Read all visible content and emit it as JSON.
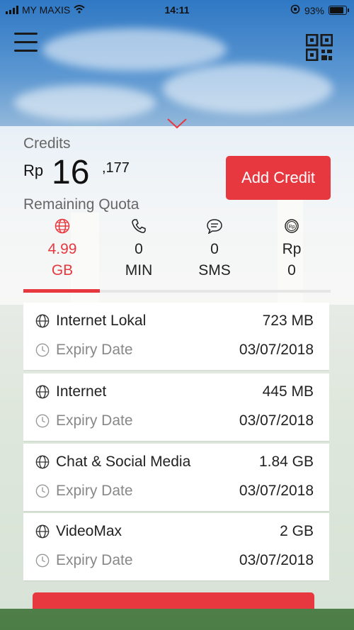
{
  "status_bar": {
    "carrier": "MY MAXIS",
    "time": "14:11",
    "battery": "93%"
  },
  "credits": {
    "label": "Credits",
    "currency": "Rp",
    "amount_main": "16",
    "amount_minor": ",177",
    "add_button": "Add Credit"
  },
  "quota": {
    "label": "Remaining Quota",
    "tabs": [
      {
        "icon": "globe-icon",
        "line1": "4.99",
        "line2": "GB",
        "active": true
      },
      {
        "icon": "phone-icon",
        "line1": "0",
        "line2": "MIN",
        "active": false
      },
      {
        "icon": "chat-icon",
        "line1": "0",
        "line2": "SMS",
        "active": false
      },
      {
        "icon": "rupiah-coin-icon",
        "line1": "Rp",
        "line2": "0",
        "active": false
      }
    ]
  },
  "packages": [
    {
      "name": "Internet Lokal",
      "amount": "723 MB",
      "expiry_label": "Expiry Date",
      "expiry": "03/07/2018"
    },
    {
      "name": "Internet",
      "amount": "445 MB",
      "expiry_label": "Expiry Date",
      "expiry": "03/07/2018"
    },
    {
      "name": "Chat & Social Media",
      "amount": "1.84 GB",
      "expiry_label": "Expiry Date",
      "expiry": "03/07/2018"
    },
    {
      "name": "VideoMax",
      "amount": "2 GB",
      "expiry_label": "Expiry Date",
      "expiry": "03/07/2018"
    }
  ],
  "colors": {
    "accent": "#e8383f"
  }
}
